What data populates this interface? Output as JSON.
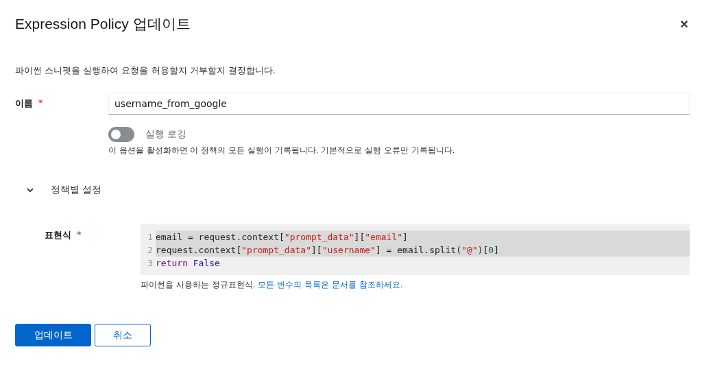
{
  "dialog": {
    "title": "Expression Policy 업데이트",
    "close": "×"
  },
  "description": "파이썬 스니펫을 실행하여 요청을 허용할지 거부할지 결정합니다.",
  "name_field": {
    "label": "이름",
    "required": "*",
    "value": "username_from_google"
  },
  "toggle": {
    "label": "실행 로깅",
    "on": false,
    "help": "이 옵션을 활성화하면 이 정책의 모든 실행이 기록됩니다. 기본적으로 실행 오류만 기록됩니다."
  },
  "section": {
    "label": "정책별 설정",
    "expanded": true
  },
  "expression": {
    "label": "표현식",
    "required": "*",
    "lines": [
      {
        "number": "1",
        "selected": true,
        "tokens": [
          {
            "kind": "plain",
            "text": "email = request.context["
          },
          {
            "kind": "string",
            "text": "\"prompt_data\""
          },
          {
            "kind": "plain",
            "text": "]["
          },
          {
            "kind": "string",
            "text": "\"email\""
          },
          {
            "kind": "plain",
            "text": "]"
          }
        ]
      },
      {
        "number": "2",
        "selected": true,
        "tokens": [
          {
            "kind": "plain",
            "text": "request.context["
          },
          {
            "kind": "string",
            "text": "\"prompt_data\""
          },
          {
            "kind": "plain",
            "text": "]["
          },
          {
            "kind": "string",
            "text": "\"username\""
          },
          {
            "kind": "plain",
            "text": "] = email.split("
          },
          {
            "kind": "string",
            "text": "\"@\""
          },
          {
            "kind": "plain",
            "text": ")["
          },
          {
            "kind": "number",
            "text": "0"
          },
          {
            "kind": "plain",
            "text": "]"
          }
        ]
      },
      {
        "number": "3",
        "selected": false,
        "tokens": [
          {
            "kind": "keyword",
            "text": "return"
          },
          {
            "kind": "constant",
            "text": "False"
          }
        ]
      }
    ],
    "help": "파이썬을 사용하는 정규표현식.",
    "help_link": "모든 변수의 목록은 문서를 참조하세요."
  },
  "buttons": [
    {
      "label": "업데이트",
      "kind": "primary"
    },
    {
      "label": "취소",
      "kind": "secondary"
    }
  ]
}
